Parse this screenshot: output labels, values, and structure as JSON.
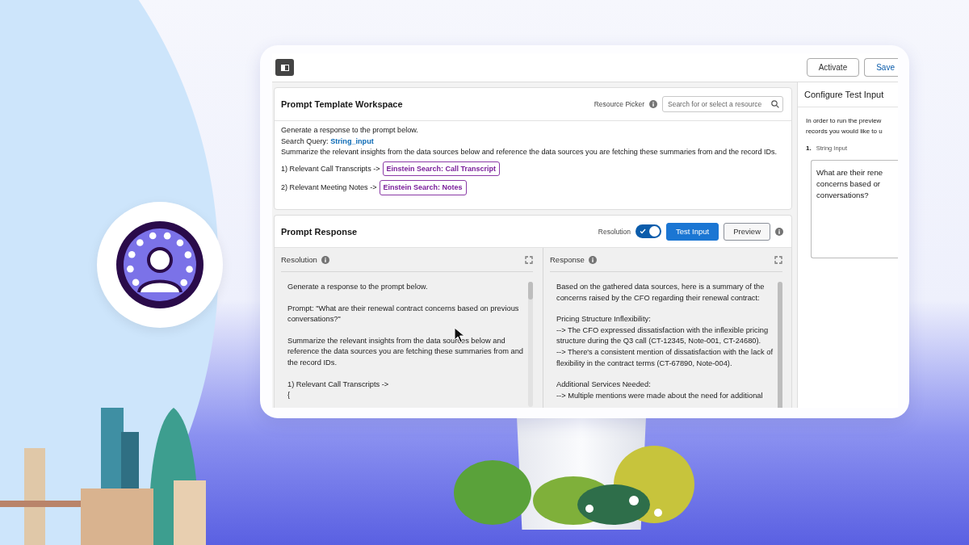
{
  "toolbar": {
    "buttons": [
      "Activate",
      "Save"
    ]
  },
  "workspace": {
    "title": "Prompt Template Workspace",
    "picker_label": "Resource Picker",
    "search": {
      "placeholder": "Search for or select a resource"
    },
    "lines": [
      "Generate a response to the prompt below.",
      "Search Query: **String_input**",
      "Summarize the relevant insights from the data sources below and reference the data sources you are fetching these summaries from and the record IDs."
    ],
    "sources": [
      {
        "label": "1)  Relevant Call Transcripts ->",
        "tag": "Einstein Search: Call Transcript"
      },
      {
        "label": "2)  Relevant Meeting Notes ->",
        "tag": "Einstein Search: Notes"
      }
    ]
  },
  "response": {
    "title": "Prompt Response",
    "toggle": {
      "label": "Resolution",
      "on": true
    },
    "buttons": [
      {
        "label": "Test Input",
        "kind": "brand"
      },
      {
        "label": "Preview",
        "kind": "outline"
      }
    ],
    "panes": [
      {
        "title": "Resolution",
        "paragraphs": [
          [
            "Generate a response to the prompt below."
          ],
          [
            "Prompt: \"What are their renewal contract concerns based on previous",
            "conversations?\""
          ],
          [
            "Summarize the relevant insights from the data sources below and",
            "reference the data sources you are fetching these summaries from and",
            "the record IDs."
          ],
          [
            "1)  Relevant Call Transcripts ->",
            "{"
          ]
        ]
      },
      {
        "title": "Response",
        "paragraphs": [
          [
            "Based on the gathered data sources, here is a summary of the",
            "concerns raised by the CFO regarding their renewal contract:"
          ],
          [
            "Pricing Structure Inflexibility:",
            "--> The CFO expressed dissatisfaction with the inflexible pricing",
            "structure during the Q3 call (CT-12345, Note-001, CT-24680).",
            "--> There's a consistent mention of dissatisfaction with the lack of",
            "flexibility in the contract terms (CT-67890, Note-004)."
          ],
          [
            "Additional Services Needed:",
            "--> Multiple mentions were made about the need for additional"
          ]
        ]
      }
    ]
  },
  "test_input": {
    "title": "Configure Test Input",
    "intro": [
      "In order to run the preview",
      "records you would like to u"
    ],
    "fields": [
      {
        "number": "1.",
        "label": "String Input",
        "value": [
          "What are their rene",
          "concerns based or",
          "conversations?"
        ]
      }
    ]
  }
}
